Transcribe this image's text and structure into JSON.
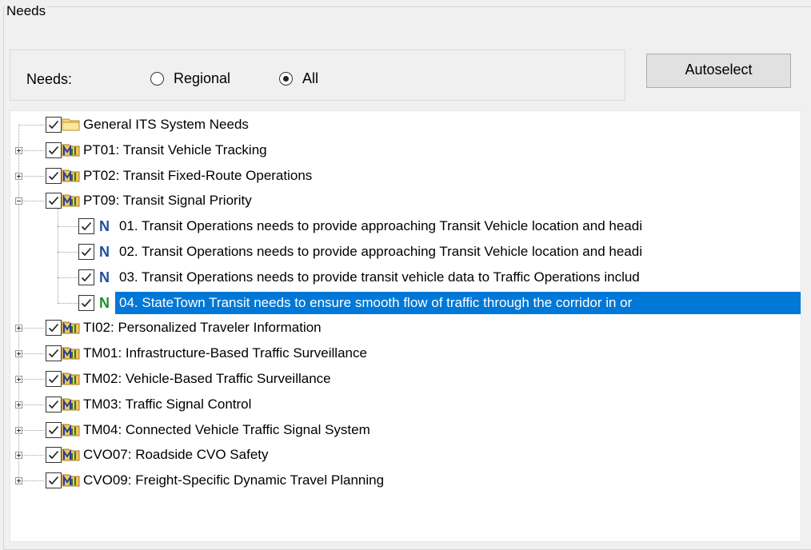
{
  "group": {
    "title": "Needs"
  },
  "needs_filter": {
    "label": "Needs:",
    "options": [
      {
        "label": "Regional",
        "selected": false
      },
      {
        "label": "All",
        "selected": true
      }
    ]
  },
  "autoselect": {
    "label": "Autoselect"
  },
  "tree": {
    "nodes": [
      {
        "label": "General ITS System Needs",
        "icon": "folder-icon",
        "checked": true,
        "expander": "none"
      },
      {
        "label": "PT01: Transit Vehicle Tracking",
        "icon": "service-package-icon",
        "checked": true,
        "expander": "plus"
      },
      {
        "label": "PT02: Transit Fixed-Route Operations",
        "icon": "service-package-icon",
        "checked": true,
        "expander": "plus"
      },
      {
        "label": "PT09: Transit Signal Priority",
        "icon": "service-package-icon",
        "checked": true,
        "expander": "minus",
        "children": [
          {
            "label": "01. Transit Operations needs to provide approaching Transit Vehicle location and headi",
            "icon": "need-N",
            "color": "#1f4e9c",
            "checked": true
          },
          {
            "label": "02. Transit Operations needs to provide approaching Transit Vehicle location and headi",
            "icon": "need-N",
            "color": "#1f4e9c",
            "checked": true
          },
          {
            "label": "03. Transit Operations needs to provide transit vehicle data to Traffic Operations includ",
            "icon": "need-N",
            "color": "#1f4e9c",
            "checked": true
          },
          {
            "label": "04. StateTown Transit needs to ensure smooth flow of traffic through the corridor in or",
            "icon": "need-N",
            "color": "#1e8f2e",
            "checked": true,
            "selected": true
          }
        ]
      },
      {
        "label": "TI02: Personalized Traveler Information",
        "icon": "service-package-icon",
        "checked": true,
        "expander": "plus"
      },
      {
        "label": "TM01: Infrastructure-Based Traffic Surveillance",
        "icon": "service-package-icon",
        "checked": true,
        "expander": "plus"
      },
      {
        "label": "TM02: Vehicle-Based Traffic Surveillance",
        "icon": "service-package-icon",
        "checked": true,
        "expander": "plus"
      },
      {
        "label": "TM03: Traffic Signal Control",
        "icon": "service-package-icon",
        "checked": true,
        "expander": "plus"
      },
      {
        "label": "TM04: Connected Vehicle Traffic Signal System",
        "icon": "service-package-icon",
        "checked": true,
        "expander": "plus"
      },
      {
        "label": "CVO07: Roadside CVO Safety",
        "icon": "service-package-icon",
        "checked": true,
        "expander": "plus"
      },
      {
        "label": "CVO09: Freight-Specific Dynamic Travel Planning",
        "icon": "service-package-icon",
        "checked": true,
        "expander": "plus"
      }
    ]
  },
  "colors": {
    "selection": "#0078d7",
    "need_default": "#1f4e9c",
    "need_selected": "#1e8f2e"
  }
}
